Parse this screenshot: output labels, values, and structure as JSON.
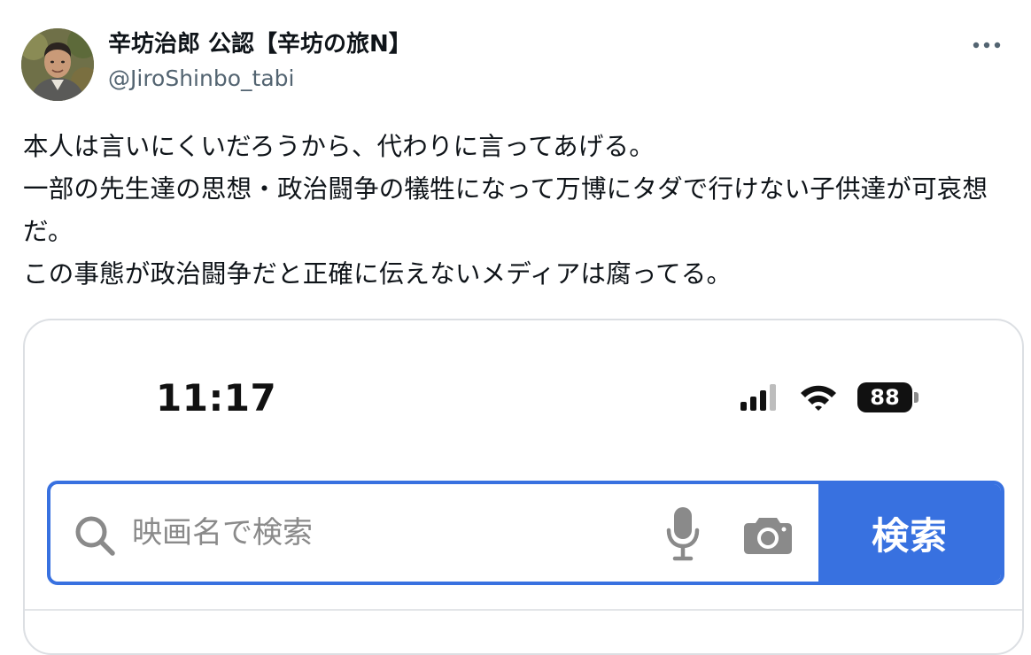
{
  "tweet": {
    "author": {
      "display_name": "辛坊治郎 公認【辛坊の旅N】",
      "handle": "@JiroShinbo_tabi",
      "avatar_icon": "user-avatar"
    },
    "more_icon": "more-horizontal-icon",
    "text": "本人は言いにくいだろうから、代わりに言ってあげる。\n一部の先生達の思想・政治闘争の犠牲になって万博にタダで行けない子供達が可哀想だ。\nこの事態が政治闘争だと正確に伝えないメディアは腐ってる。"
  },
  "screenshot": {
    "status_bar": {
      "time": "11:17",
      "battery": "88",
      "icons": [
        "signal-icon",
        "wifi-icon",
        "battery-icon"
      ]
    },
    "search": {
      "placeholder": "映画名で検索",
      "button_label": "検索",
      "icons": [
        "search-icon",
        "mic-icon",
        "camera-icon"
      ]
    }
  },
  "colors": {
    "accent": "#3871e0",
    "text_primary": "#0f1419",
    "text_secondary": "#536471",
    "card_border": "#dcdfe3"
  }
}
